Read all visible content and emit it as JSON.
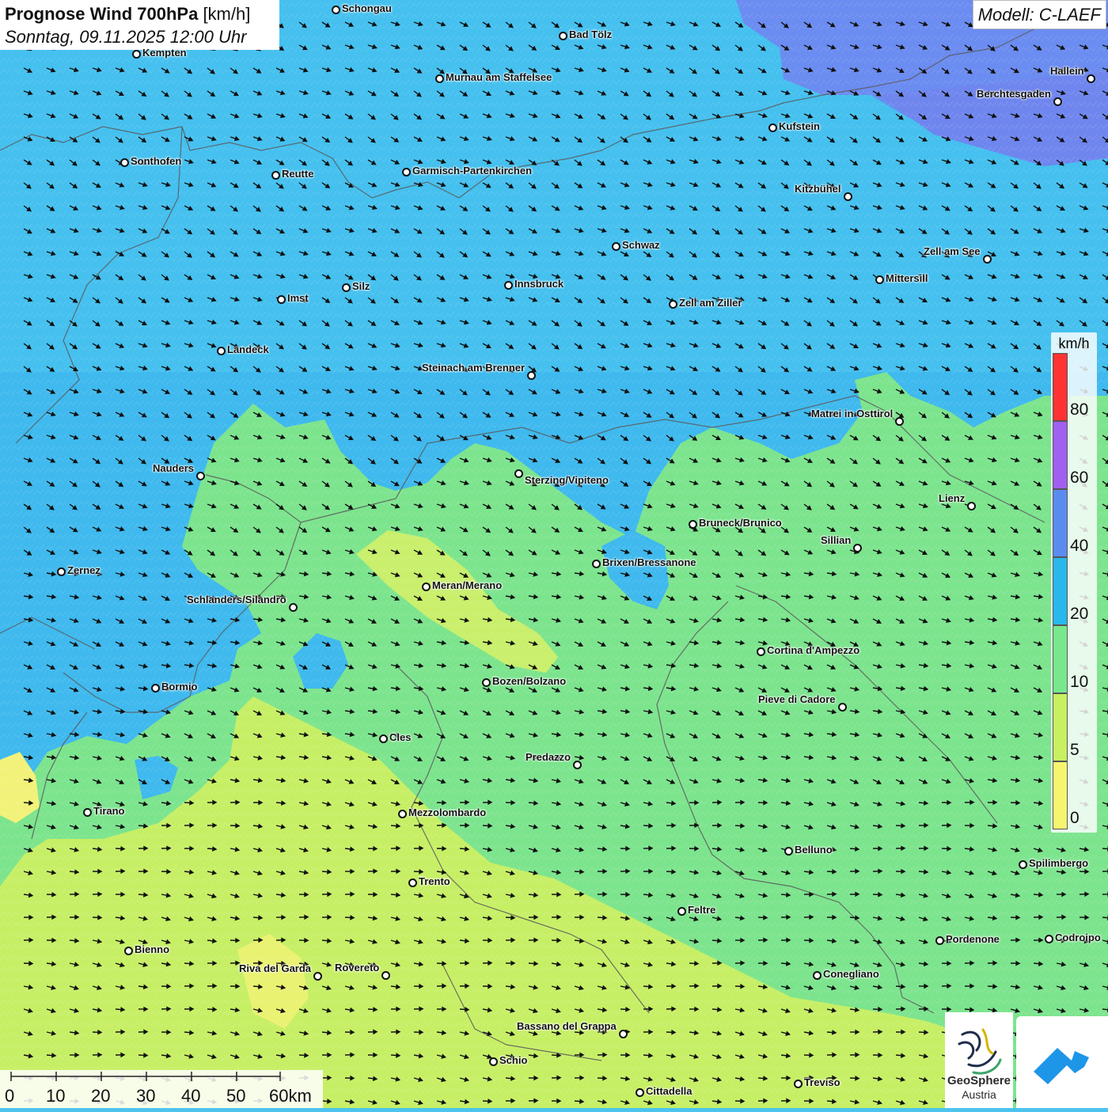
{
  "title": {
    "bold": "Prognose Wind 700hPa",
    "unit": "[km/h]",
    "date": "Sonntag, 09.11.2025 12:00 Uhr"
  },
  "model": "Modell: C-LAEF",
  "legend": {
    "unit": "km/h",
    "ticks": [
      "80",
      "60",
      "40",
      "20",
      "10",
      "5",
      "0"
    ],
    "colors": [
      "#ff3333",
      "#a060f0",
      "#5a8cf0",
      "#29b8ec",
      "#78e88c",
      "#c8f060",
      "#f5f570",
      "#b8e8f8"
    ]
  },
  "scale": {
    "labels": [
      "0",
      "10",
      "20",
      "30",
      "40",
      "50",
      "60km"
    ]
  },
  "logo": {
    "name1": "GeoSphere",
    "name2": "Austria"
  },
  "cities": [
    {
      "name": "Schongau"
    },
    {
      "name": "Bad Tölz"
    },
    {
      "name": "Kempten"
    },
    {
      "name": "Murnau am Staffelsee"
    },
    {
      "name": "Hallein"
    },
    {
      "name": "Berchtesgaden"
    },
    {
      "name": "Kufstein"
    },
    {
      "name": "Sonthofen"
    },
    {
      "name": "Reutte"
    },
    {
      "name": "Garmisch-Partenkirchen"
    },
    {
      "name": "Kitzbühel"
    },
    {
      "name": "Schwaz"
    },
    {
      "name": "Zell am See"
    },
    {
      "name": "Mittersill"
    },
    {
      "name": "Innsbruck"
    },
    {
      "name": "Silz"
    },
    {
      "name": "Imst"
    },
    {
      "name": "Zell am Ziller"
    },
    {
      "name": "Landeck"
    },
    {
      "name": "Steinach am Brenner"
    },
    {
      "name": "Matrei in Osttirol"
    },
    {
      "name": "Nauders"
    },
    {
      "name": "Sterzing/Vipiteno"
    },
    {
      "name": "Lienz"
    },
    {
      "name": "Bruneck/Brunico"
    },
    {
      "name": "Sillian"
    },
    {
      "name": "Brixen/Bressanone"
    },
    {
      "name": "Zernez"
    },
    {
      "name": "Meran/Merano"
    },
    {
      "name": "Schlanders/Silandro"
    },
    {
      "name": "Cortina d'Ampezzo"
    },
    {
      "name": "Bozen/Bolzano"
    },
    {
      "name": "Bormio"
    },
    {
      "name": "Pieve di Cadore"
    },
    {
      "name": "Cles"
    },
    {
      "name": "Predazzo"
    },
    {
      "name": "Tirano"
    },
    {
      "name": "Mezzolombardo"
    },
    {
      "name": "Belluno"
    },
    {
      "name": "Spilimbergo"
    },
    {
      "name": "Trento"
    },
    {
      "name": "Feltre"
    },
    {
      "name": "Pordenone"
    },
    {
      "name": "Codroipo"
    },
    {
      "name": "Bienno"
    },
    {
      "name": "Riva del Garda"
    },
    {
      "name": "Rovereto"
    },
    {
      "name": "Conegliano"
    },
    {
      "name": "Bassano del Grappa"
    },
    {
      "name": "Schio"
    },
    {
      "name": "Treviso"
    },
    {
      "name": "Cittadella"
    }
  ]
}
